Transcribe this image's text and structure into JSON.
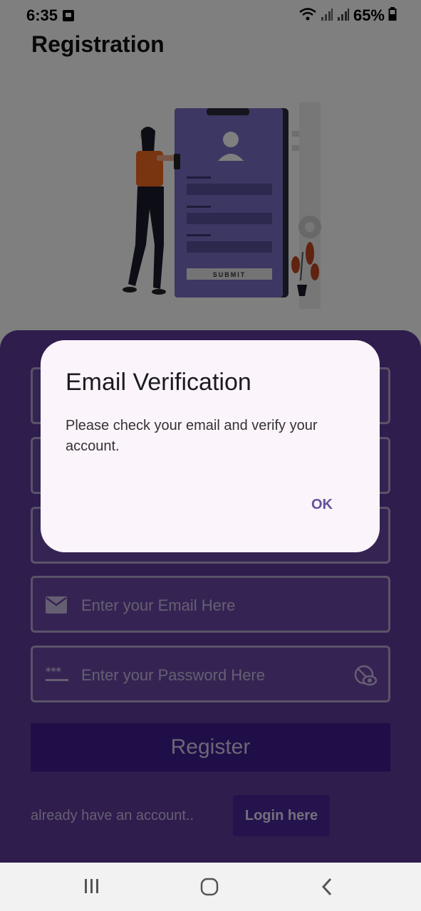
{
  "status_bar": {
    "time": "6:35",
    "battery": "65%",
    "icons": [
      "notification-icon",
      "wifi-icon",
      "signal-icon",
      "signal-icon",
      "battery-icon"
    ]
  },
  "page": {
    "title": "Registration",
    "illustration_button_label": "SUBMIT"
  },
  "form": {
    "email_placeholder": "Enter your Email Here",
    "password_placeholder": "Enter your Password Here",
    "register_label": "Register",
    "already_text": "already have an account..",
    "login_label": "Login here"
  },
  "dialog": {
    "title": "Email Verification",
    "message": "Please check your email and verify your account.",
    "ok_label": "OK"
  },
  "colors": {
    "panel": "#5f3a9c",
    "register_button": "#3f1d8f",
    "dialog_bg": "#fcf4fb",
    "dialog_action": "#62529a"
  }
}
